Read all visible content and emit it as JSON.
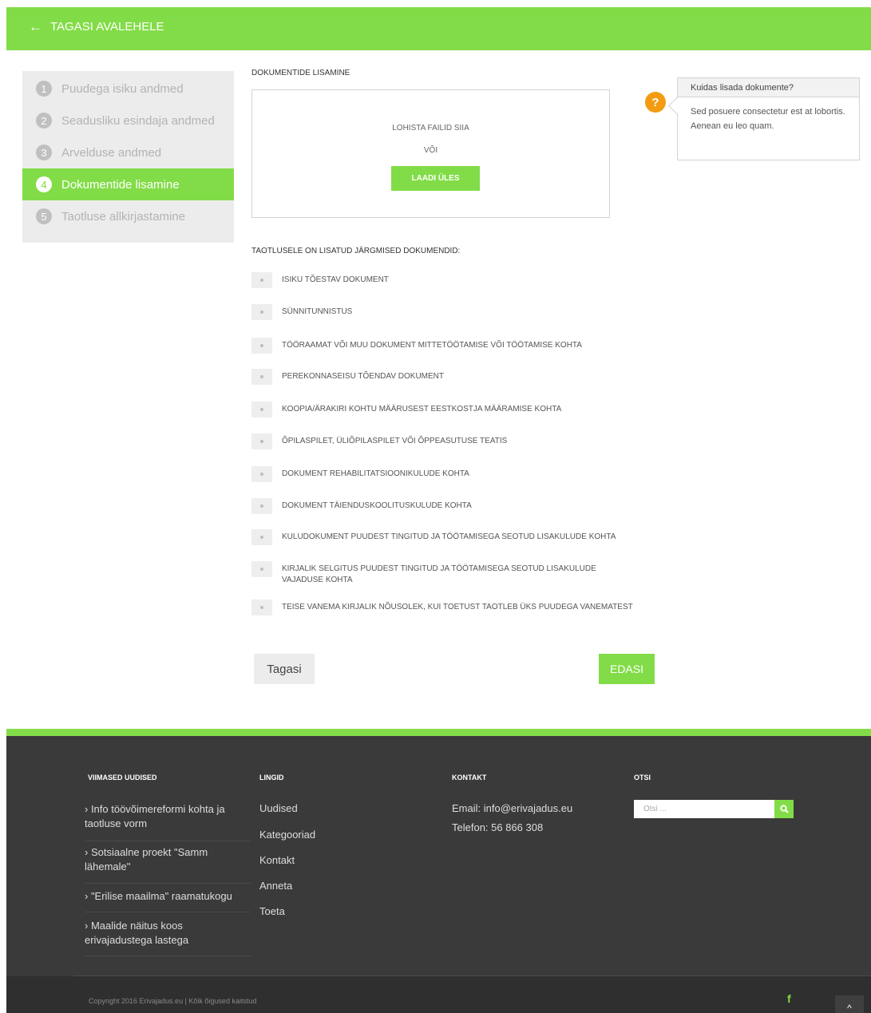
{
  "header": {
    "back_label": "TAGASI AVALEHELE",
    "back_icon": "arrow-left-icon"
  },
  "steps": [
    {
      "num": "1",
      "label": "Puudega isiku andmed",
      "active": false
    },
    {
      "num": "2",
      "label": "Seadusliku esindaja andmed",
      "active": false
    },
    {
      "num": "3",
      "label": "Arvelduse andmed",
      "active": false
    },
    {
      "num": "4",
      "label": "Dokumentide lisamine",
      "active": true
    },
    {
      "num": "5",
      "label": "Taotluse allkirjastamine",
      "active": false
    }
  ],
  "upload": {
    "title": "DOKUMENTIDE LISAMINE",
    "drop_text": "LOHISTA FAILID SIIA",
    "or_text": "VÕI",
    "button_label": "LAADI ÜLES"
  },
  "help": {
    "icon": "question-icon",
    "icon_glyph": "?",
    "title": "Kuidas lisada dokumente?",
    "body": "Sed posuere consectetur est at lobortis. Aenean eu leo quam."
  },
  "documents": {
    "title": "TAOTLUSELE ON LISATUD JÄRGMISED DOKUMENDID:",
    "items": [
      "ISIKU TÕESTAV DOKUMENT",
      "SÜNNITUNNISTUS",
      "TÖÖRAAMAT VÕI MUU DOKUMENT MITTETÖÖTAMISE VÕI TÖÖTAMISE KOHTA",
      "PEREKONNASEISU TÕENDAV DOKUMENT",
      "KOOPIA/ÄRAKIRI KOHTU MÄÄRUSEST EESTKOSTJA MÄÄRAMISE KOHTA",
      "ÕPILASPILET, ÜLIÕPILASPILET VÕI ÕPPEASUTUSE TEATIS",
      "DOKUMENT REHABILITATSIOONIKULUDE KOHTA",
      "DOKUMENT TÄIENDUSKOOLITUSKULUDE KOHTA",
      "KULUDOKUMENT PUUDEST TINGITUD JA TÖÖTAMISEGA SEOTUD LISAKULUDE KOHTA",
      "KIRJALIK SELGITUS PUUDEST TINGITUD JA TÖÖTAMISEGA SEOTUD LISAKULUDE VAJADUSE KOHTA",
      "TEISE VANEMA KIRJALIK NÕUSOLEK, KUI TOETUST TAOTLEB ÜKS PUUDEGA VANEMATEST"
    ]
  },
  "nav": {
    "back_label": "Tagasi",
    "next_label": "EDASI"
  },
  "footer": {
    "news_title": "VIIMASED UUDISED",
    "news": [
      "› Info töövõimereformi kohta ja taotluse vorm",
      "› Sotsiaalne proekt \"Samm lähemale\"",
      "› \"Erilise maailma\" raamatukogu",
      "› Maalide näitus koos erivajadustega lastega"
    ],
    "links_title": "LINGID",
    "links": [
      "Uudised",
      "Kategooriad",
      "Kontakt",
      "Anneta",
      "Toeta"
    ],
    "contact_title": "KONTAKT",
    "email": "Email: info@erivajadus.eu",
    "phone": "Telefon: 56 866 308",
    "search_title": "OTSI",
    "search_placeholder": "Otsi ...",
    "copyright": "Copyright 2016 Erivajadus.eu | Kõik õigused kaitstud",
    "facebook_glyph": "f",
    "totop_glyph": "^"
  },
  "colors": {
    "accent": "#82dc47",
    "help": "#f39c12",
    "footer": "#3a3a3a"
  }
}
